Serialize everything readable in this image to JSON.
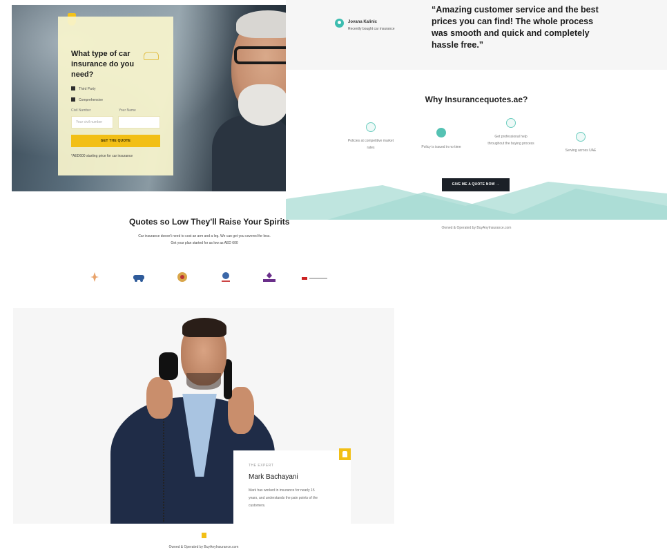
{
  "hero": {
    "question": "What type of car insurance do you need?",
    "options": [
      "Third Party",
      "Comprehensive"
    ],
    "civil_label": "Civil Number",
    "name_label": "Your Name",
    "civil_placeholder": "Your civil number",
    "name_placeholder": "",
    "cta": "GET THE QUOTE",
    "note": "*AED600 starting price for car insurance"
  },
  "testimonial": {
    "name": "Jovana Kalinic",
    "sub": "Recently bought car insurance",
    "quote": "“Amazing customer service and the best prices you can find! The whole process was smooth and quick and completely hassle free.”"
  },
  "why": {
    "title": "Why Insurancequotes.ae?",
    "features": [
      {
        "icon": "percent-icon",
        "text": "Policies at competitive market rates"
      },
      {
        "icon": "clock-icon",
        "text": "Policy is issued in no time"
      },
      {
        "icon": "headset-icon",
        "text": "Get professional help throughout the buying process"
      },
      {
        "icon": "refresh-icon",
        "text": "Serving across UAE"
      }
    ],
    "cta": "GIVE ME A QUOTE NOW  →",
    "owned": "Owned & Operated by BuyAnyInsurance.com"
  },
  "low": {
    "title": "Quotes so Low They'll Raise Your Spirits",
    "sub1": "Car insurance doesn't need to cost an arm and a leg. We can get you covered for less.",
    "sub2": "Get your plan started for as low as AED 600"
  },
  "partners": [
    "partner-logo-1",
    "partner-logo-2",
    "partner-logo-3",
    "partner-logo-4",
    "partner-logo-5",
    "partner-logo-6"
  ],
  "expert": {
    "tag": "THE EXPERT",
    "name": "Mark Bachayani",
    "desc": "Mark has worked in insurance for nearly 15 years, and understands the pain points of the customers."
  },
  "footer": {
    "owned": "Owned & Operated by BuyAnyInsurance.com"
  },
  "colors": {
    "accent": "#f2bf16",
    "teal": "#55c2b3",
    "dark": "#1b2027"
  }
}
